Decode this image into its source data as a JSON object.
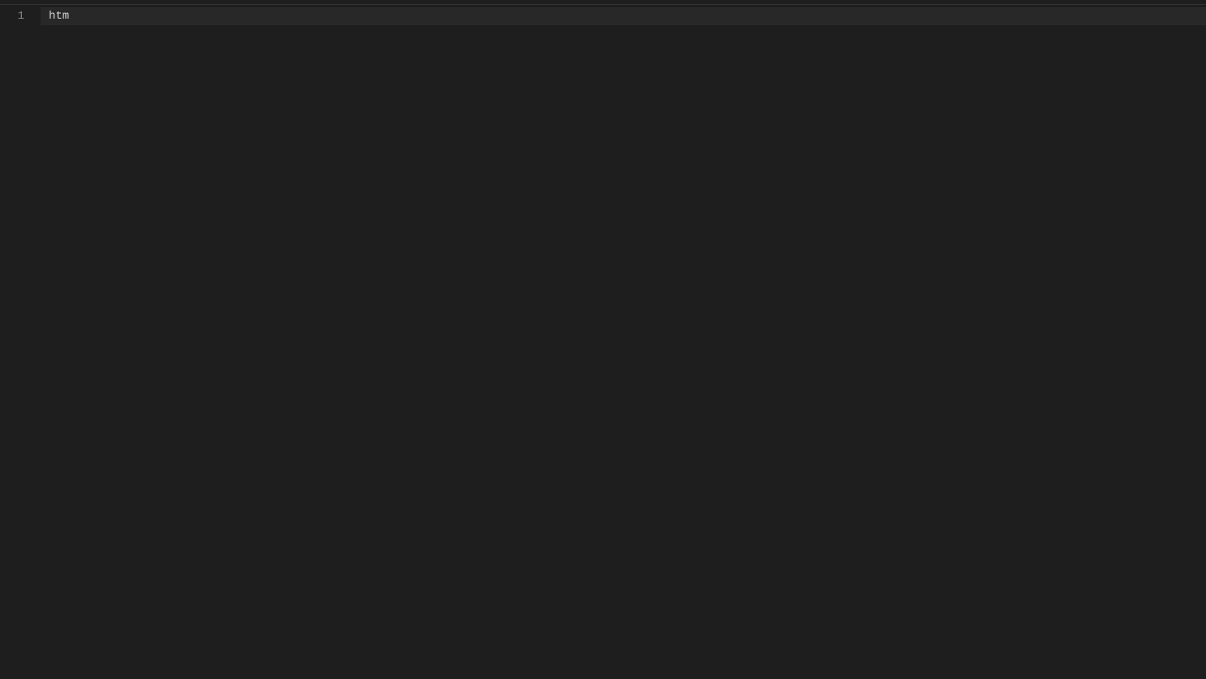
{
  "editor": {
    "lines": [
      {
        "number": "1",
        "content": "htm"
      }
    ],
    "current_line_index": 0
  }
}
